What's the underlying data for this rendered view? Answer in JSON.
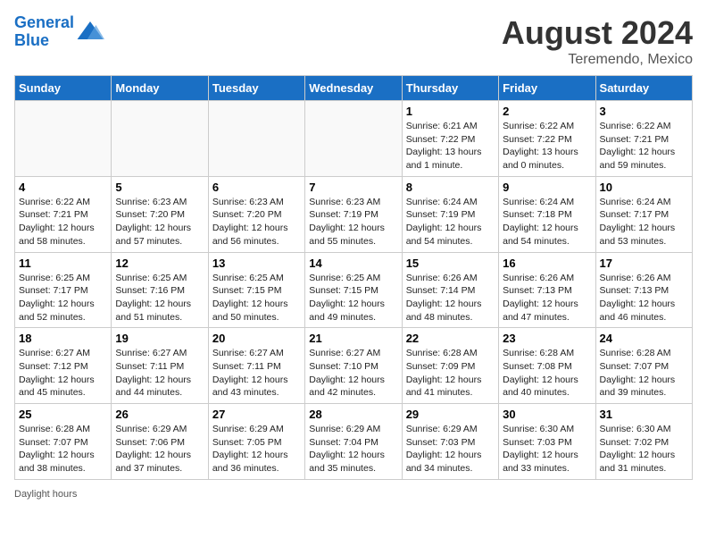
{
  "header": {
    "logo_line1": "General",
    "logo_line2": "Blue",
    "title": "August 2024",
    "location": "Teremendo, Mexico"
  },
  "days_of_week": [
    "Sunday",
    "Monday",
    "Tuesday",
    "Wednesday",
    "Thursday",
    "Friday",
    "Saturday"
  ],
  "weeks": [
    [
      {
        "day": "",
        "info": ""
      },
      {
        "day": "",
        "info": ""
      },
      {
        "day": "",
        "info": ""
      },
      {
        "day": "",
        "info": ""
      },
      {
        "day": "1",
        "info": "Sunrise: 6:21 AM\nSunset: 7:22 PM\nDaylight: 13 hours and 1 minute."
      },
      {
        "day": "2",
        "info": "Sunrise: 6:22 AM\nSunset: 7:22 PM\nDaylight: 13 hours and 0 minutes."
      },
      {
        "day": "3",
        "info": "Sunrise: 6:22 AM\nSunset: 7:21 PM\nDaylight: 12 hours and 59 minutes."
      }
    ],
    [
      {
        "day": "4",
        "info": "Sunrise: 6:22 AM\nSunset: 7:21 PM\nDaylight: 12 hours and 58 minutes."
      },
      {
        "day": "5",
        "info": "Sunrise: 6:23 AM\nSunset: 7:20 PM\nDaylight: 12 hours and 57 minutes."
      },
      {
        "day": "6",
        "info": "Sunrise: 6:23 AM\nSunset: 7:20 PM\nDaylight: 12 hours and 56 minutes."
      },
      {
        "day": "7",
        "info": "Sunrise: 6:23 AM\nSunset: 7:19 PM\nDaylight: 12 hours and 55 minutes."
      },
      {
        "day": "8",
        "info": "Sunrise: 6:24 AM\nSunset: 7:19 PM\nDaylight: 12 hours and 54 minutes."
      },
      {
        "day": "9",
        "info": "Sunrise: 6:24 AM\nSunset: 7:18 PM\nDaylight: 12 hours and 54 minutes."
      },
      {
        "day": "10",
        "info": "Sunrise: 6:24 AM\nSunset: 7:17 PM\nDaylight: 12 hours and 53 minutes."
      }
    ],
    [
      {
        "day": "11",
        "info": "Sunrise: 6:25 AM\nSunset: 7:17 PM\nDaylight: 12 hours and 52 minutes."
      },
      {
        "day": "12",
        "info": "Sunrise: 6:25 AM\nSunset: 7:16 PM\nDaylight: 12 hours and 51 minutes."
      },
      {
        "day": "13",
        "info": "Sunrise: 6:25 AM\nSunset: 7:15 PM\nDaylight: 12 hours and 50 minutes."
      },
      {
        "day": "14",
        "info": "Sunrise: 6:25 AM\nSunset: 7:15 PM\nDaylight: 12 hours and 49 minutes."
      },
      {
        "day": "15",
        "info": "Sunrise: 6:26 AM\nSunset: 7:14 PM\nDaylight: 12 hours and 48 minutes."
      },
      {
        "day": "16",
        "info": "Sunrise: 6:26 AM\nSunset: 7:13 PM\nDaylight: 12 hours and 47 minutes."
      },
      {
        "day": "17",
        "info": "Sunrise: 6:26 AM\nSunset: 7:13 PM\nDaylight: 12 hours and 46 minutes."
      }
    ],
    [
      {
        "day": "18",
        "info": "Sunrise: 6:27 AM\nSunset: 7:12 PM\nDaylight: 12 hours and 45 minutes."
      },
      {
        "day": "19",
        "info": "Sunrise: 6:27 AM\nSunset: 7:11 PM\nDaylight: 12 hours and 44 minutes."
      },
      {
        "day": "20",
        "info": "Sunrise: 6:27 AM\nSunset: 7:11 PM\nDaylight: 12 hours and 43 minutes."
      },
      {
        "day": "21",
        "info": "Sunrise: 6:27 AM\nSunset: 7:10 PM\nDaylight: 12 hours and 42 minutes."
      },
      {
        "day": "22",
        "info": "Sunrise: 6:28 AM\nSunset: 7:09 PM\nDaylight: 12 hours and 41 minutes."
      },
      {
        "day": "23",
        "info": "Sunrise: 6:28 AM\nSunset: 7:08 PM\nDaylight: 12 hours and 40 minutes."
      },
      {
        "day": "24",
        "info": "Sunrise: 6:28 AM\nSunset: 7:07 PM\nDaylight: 12 hours and 39 minutes."
      }
    ],
    [
      {
        "day": "25",
        "info": "Sunrise: 6:28 AM\nSunset: 7:07 PM\nDaylight: 12 hours and 38 minutes."
      },
      {
        "day": "26",
        "info": "Sunrise: 6:29 AM\nSunset: 7:06 PM\nDaylight: 12 hours and 37 minutes."
      },
      {
        "day": "27",
        "info": "Sunrise: 6:29 AM\nSunset: 7:05 PM\nDaylight: 12 hours and 36 minutes."
      },
      {
        "day": "28",
        "info": "Sunrise: 6:29 AM\nSunset: 7:04 PM\nDaylight: 12 hours and 35 minutes."
      },
      {
        "day": "29",
        "info": "Sunrise: 6:29 AM\nSunset: 7:03 PM\nDaylight: 12 hours and 34 minutes."
      },
      {
        "day": "30",
        "info": "Sunrise: 6:30 AM\nSunset: 7:03 PM\nDaylight: 12 hours and 33 minutes."
      },
      {
        "day": "31",
        "info": "Sunrise: 6:30 AM\nSunset: 7:02 PM\nDaylight: 12 hours and 31 minutes."
      }
    ]
  ],
  "footer": {
    "label": "Daylight hours"
  },
  "colors": {
    "header_bg": "#1a6fc4",
    "header_text": "#ffffff",
    "border": "#cccccc"
  }
}
